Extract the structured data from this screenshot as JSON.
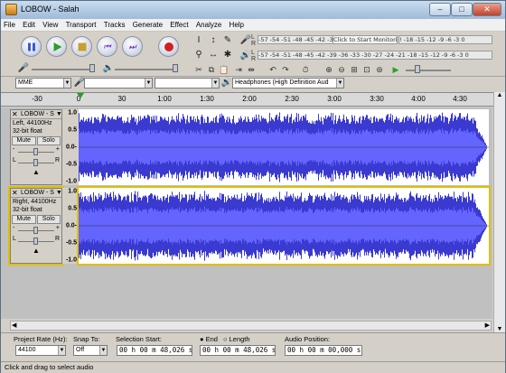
{
  "window": {
    "title": "LOBOW - Salah",
    "minimize": "–",
    "maximize": "□",
    "close": "✕"
  },
  "menu": [
    "File",
    "Edit",
    "View",
    "Transport",
    "Tracks",
    "Generate",
    "Effect",
    "Analyze",
    "Help"
  ],
  "transport": {
    "pause": "pause-icon",
    "play": "play-icon",
    "stop": "stop-icon",
    "rewind": "skip-start-icon",
    "forward": "skip-end-icon",
    "record": "record-icon"
  },
  "meters": {
    "record_label": "L\nR",
    "record_scale": "-57 -54 -51 -48 -45 -42 -3",
    "monitor_prompt": "Click to Start Monitoring",
    "monitor_scale": "! -18 -15 -12 -9 -6 -3 0",
    "play_scale": "-57 -54 -51 -48 -45 -42 -39 -36 -33 -30 -27 -24 -21 -18 -15 -12 -9 -6 -3 0"
  },
  "devices": {
    "host": "MME",
    "playback": "Headphones (High Definition Aud"
  },
  "ruler": [
    "-30",
    "0",
    "30",
    "1:00",
    "1:30",
    "2:00",
    "2:30",
    "3:00",
    "3:30",
    "4:00",
    "4:30"
  ],
  "tracks": [
    {
      "name": "LOBOW - S",
      "channel": "Left, 44100Hz",
      "format": "32-bit float",
      "mute": "Mute",
      "solo": "Solo",
      "pan_l": "L",
      "pan_r": "R",
      "y_labels": [
        "1.0",
        "0.5",
        "0.0-",
        "-0.5",
        "-1.0"
      ]
    },
    {
      "name": "LOBOW - S",
      "channel": "Right, 44100Hz",
      "format": "32-bit float",
      "mute": "Mute",
      "solo": "Solo",
      "pan_l": "L",
      "pan_r": "R",
      "y_labels": [
        "1.0",
        "0.5",
        "0.0-",
        "-0.5",
        "-1.0"
      ]
    }
  ],
  "selection": {
    "rate_label": "Project Rate (Hz):",
    "rate_value": "44100",
    "snap_label": "Snap To:",
    "snap_value": "Off",
    "start_label": "Selection Start:",
    "start_value": "00 h 00 m 48,026 s",
    "end_label": "End",
    "length_label": "Length",
    "end_value": "00 h 00 m 48,026 s",
    "pos_label": "Audio Position:",
    "pos_value": "00 h 00 m 00,000 s"
  },
  "status": "Click and drag to select audio",
  "colors": {
    "wave": "#3a3ad0",
    "wave_rms": "#6464ff",
    "selected_border": "#e0c000"
  }
}
